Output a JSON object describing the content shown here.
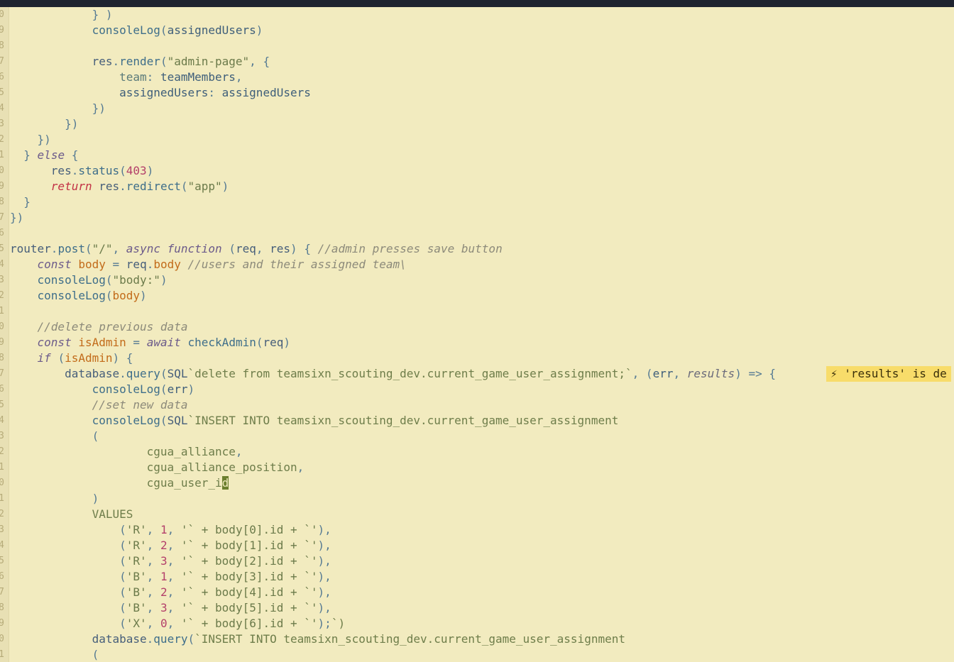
{
  "editor": {
    "lines": [
      {
        "ln": "0",
        "code": "            } )"
      },
      {
        "ln": "9",
        "code": "            consoleLog(assignedUsers)"
      },
      {
        "ln": "8",
        "code": ""
      },
      {
        "ln": "7",
        "code": "            res.render(\"admin-page\", {"
      },
      {
        "ln": "6",
        "code": "                team: teamMembers,"
      },
      {
        "ln": "5",
        "code": "                assignedUsers: assignedUsers"
      },
      {
        "ln": "4",
        "code": "            })"
      },
      {
        "ln": "3",
        "code": "        })"
      },
      {
        "ln": "2",
        "code": "    })"
      },
      {
        "ln": "1",
        "code": "  } else {"
      },
      {
        "ln": "0",
        "code": "      res.status(403)"
      },
      {
        "ln": "9",
        "code": "      return res.redirect(\"app\")"
      },
      {
        "ln": "8",
        "code": "  }"
      },
      {
        "ln": "7",
        "code": "})"
      },
      {
        "ln": "6",
        "code": ""
      },
      {
        "ln": "5",
        "code": "router.post(\"/\", async function (req, res) { //admin presses save button"
      },
      {
        "ln": "4",
        "code": "    const body = req.body //users and their assigned team\\"
      },
      {
        "ln": "3",
        "code": "    consoleLog(\"body:\")"
      },
      {
        "ln": "2",
        "code": "    consoleLog(body)"
      },
      {
        "ln": "1",
        "code": ""
      },
      {
        "ln": "0",
        "code": "    //delete previous data"
      },
      {
        "ln": "9",
        "code": "    const isAdmin = await checkAdmin(req)"
      },
      {
        "ln": "8",
        "code": "    if (isAdmin) {"
      },
      {
        "ln": "7",
        "code": "        database.query(SQL`delete from teamsixn_scouting_dev.current_game_user_assignment;`, (err, results) => {"
      },
      {
        "ln": "6",
        "code": "            consoleLog(err)"
      },
      {
        "ln": "5",
        "code": "            //set new data"
      },
      {
        "ln": "4",
        "code": "            consoleLog(SQL`INSERT INTO teamsixn_scouting_dev.current_game_user_assignment"
      },
      {
        "ln": "3",
        "code": "            ("
      },
      {
        "ln": "2",
        "code": "                    cgua_alliance,"
      },
      {
        "ln": "1",
        "code": "                    cgua_alliance_position,"
      },
      {
        "ln": "0",
        "code": "                    cgua_user_id"
      },
      {
        "ln": "1",
        "code": "            )"
      },
      {
        "ln": "2",
        "code": "            VALUES"
      },
      {
        "ln": "3",
        "code": "                ('R', 1, '` + body[0].id + `'),"
      },
      {
        "ln": "4",
        "code": "                ('R', 2, '` + body[1].id + `'),"
      },
      {
        "ln": "5",
        "code": "                ('R', 3, '` + body[2].id + `'),"
      },
      {
        "ln": "6",
        "code": "                ('B', 1, '` + body[3].id + `'),"
      },
      {
        "ln": "7",
        "code": "                ('B', 2, '` + body[4].id + `'),"
      },
      {
        "ln": "8",
        "code": "                ('B', 3, '` + body[5].id + `'),"
      },
      {
        "ln": "9",
        "code": "                ('X', 0, '` + body[6].id + `');`)"
      },
      {
        "ln": "0",
        "code": "            database.query(`INSERT INTO teamsixn_scouting_dev.current_game_user_assignment"
      },
      {
        "ln": "1",
        "code": "            ("
      }
    ],
    "inline_hint": {
      "icon": "lightning-bolt-icon",
      "text": "⚡ 'results' is de"
    }
  }
}
